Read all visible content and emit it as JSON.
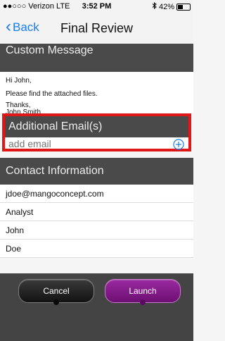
{
  "status_bar": {
    "carrier": "●●○○○ Verizon",
    "network": "LTE",
    "time": "3:52 PM",
    "battery_text": "42%",
    "battery_level": 0.42,
    "bluetooth_icon": "bluetooth-icon",
    "battery_icon": "battery-icon"
  },
  "nav": {
    "back_label": "Back",
    "back_icon": "chevron-left-icon",
    "title": "Final Review"
  },
  "custom_message": {
    "header": "Custom Message",
    "greeting": "Hi John,",
    "body": "Please find the attached files.",
    "closing": "Thanks,",
    "signature": "John Smith"
  },
  "additional_emails": {
    "header": "Additional Email(s)",
    "placeholder": "add email",
    "value": "",
    "add_icon": "plus-circle-icon"
  },
  "contact_information": {
    "header": "Contact Information",
    "email": "jdoe@mangoconcept.com",
    "title": "Analyst",
    "first_name": "John",
    "last_name": "Doe"
  },
  "actions": {
    "cancel_label": "Cancel",
    "launch_label": "Launch"
  },
  "colors": {
    "accent_blue": "#1a7cf4",
    "highlight_red": "#e01717",
    "section_header": "#4a4a4a",
    "launch_purple": "#8a1e92"
  }
}
